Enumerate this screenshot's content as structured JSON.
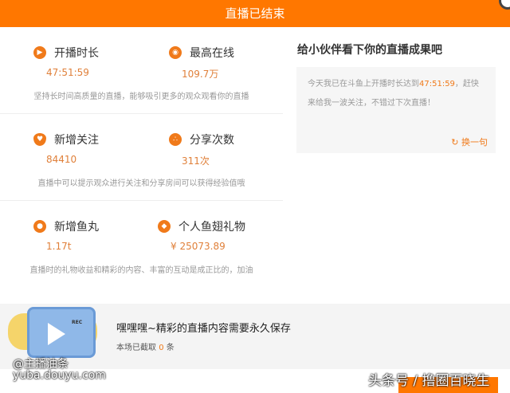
{
  "header": {
    "title": "直播已结束"
  },
  "stats": [
    {
      "items": [
        {
          "label": "开播时长",
          "value": "47:51:59",
          "icon": "play-icon"
        },
        {
          "label": "最高在线",
          "value": "109.7万",
          "icon": "eye-icon"
        }
      ],
      "desc": "坚持长时间高质量的直播，能够吸引更多的观众观看你的直播"
    },
    {
      "items": [
        {
          "label": "新增关注",
          "value": "84410",
          "icon": "heart-icon"
        },
        {
          "label": "分享次数",
          "value": "311次",
          "icon": "share-icon"
        }
      ],
      "desc": "直播中可以提示观众进行关注和分享房间可以获得经验值哦"
    },
    {
      "items": [
        {
          "label": "新增鱼丸",
          "value": "1.17t",
          "icon": "fishball-icon"
        },
        {
          "label": "个人鱼翅礼物",
          "value": "¥ 25073.89",
          "icon": "gift-icon"
        }
      ],
      "desc": "直播时的礼物收益和精彩的内容、丰富的互动是成正比的，加油"
    }
  ],
  "share": {
    "title": "给小伙伴看下你的直播成果吧",
    "text_before": "今天我已在斗鱼上开播时长达到",
    "highlight": "47:51:59",
    "text_after": "，赶快来给我一波关注，不错过下次直播！",
    "swap_label": "换一句"
  },
  "bottom": {
    "title": "嘿嘿嘿~精彩的直播内容需要永久保存",
    "sub_before": "本场已截取",
    "count": "0",
    "sub_after": "条",
    "rec": "REC"
  },
  "watermarks": {
    "author": "@主播油条",
    "site": "yuba.douyu.com",
    "toutiao": "头条号 / 撸圈百晓生"
  },
  "colors": {
    "accent": "#ff7700"
  }
}
